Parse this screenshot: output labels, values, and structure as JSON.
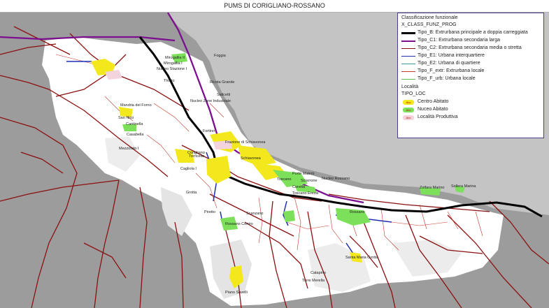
{
  "title": "PUMS DI CORIGLIANO-ROSSANO",
  "legend": {
    "section1_title": "Classificazione funzionale",
    "section1_field": "X_CLASS_FUNZ_PROG",
    "road_classes": [
      {
        "label": "Tipo_B: Extrurbana principale a doppia carreggiata",
        "color": "#000000",
        "width": 3
      },
      {
        "label": "Tipo_C1: Extrurbana secondaria larga",
        "color": "#7b0f8f",
        "width": 2.5
      },
      {
        "label": "Tipo_C2: Extrurbana secondaria media o stretta",
        "color": "#8b1010",
        "width": 1.5
      },
      {
        "label": "Tipo_E1: Urbana interquartiere",
        "color": "#1f2fb0",
        "width": 1.5
      },
      {
        "label": "Tipo_E2: Urbana di quartiere",
        "color": "#3a9a9a",
        "width": 1
      },
      {
        "label": "Tipo_F_extr: Extrurbana locale",
        "color": "#c0392b",
        "width": 0.8
      },
      {
        "label": "Tipo_F_urb: Urbana locale",
        "color": "#5cbf4c",
        "width": 0.8
      }
    ],
    "section2_title": "Località",
    "section2_field": "TIPO_LOC",
    "locality_types": [
      {
        "label": "Centro Abitato",
        "color": "#f2e81c",
        "sym": "Abc"
      },
      {
        "label": "Nuceo Abitato",
        "color": "#7ce05a",
        "sym": "Abc"
      },
      {
        "label": "Località Produttiva",
        "color": "#f4d4dc",
        "sym": "Abc"
      }
    ]
  },
  "places": [
    "Foggia",
    "Mirogallia II",
    "Mirogallia I",
    "Nucleo Stazione I",
    "Thurio",
    "Ricota Grande",
    "Salicetti",
    "Nucleo Zone Industriale",
    "Mandria del Forno",
    "San Nico",
    "Cantinella",
    "Casabella",
    "Mezzofato I",
    "Fortino",
    "Frazione di Schiavonea",
    "Schiavonea",
    "Corigliano",
    "Cagliola I",
    "Torricella",
    "Grotta",
    "Porto Malerù",
    "Toscano",
    "Sciarrone",
    "Coretta",
    "Nucleo Rossano",
    "Toscano Erecle",
    "Zolfara Marino",
    "Sollera Marina",
    "Rossano",
    "Piretto",
    "Rossano Centro",
    "Scanzano",
    "Santa Maria Grotta",
    "Catapino",
    "Torre Merella",
    "Piano Savelli"
  ],
  "colors": {
    "land": "#ffffff",
    "outside": "#9c9c9c",
    "sea": "#c4c4c4",
    "hills": "#e6e6e6"
  }
}
